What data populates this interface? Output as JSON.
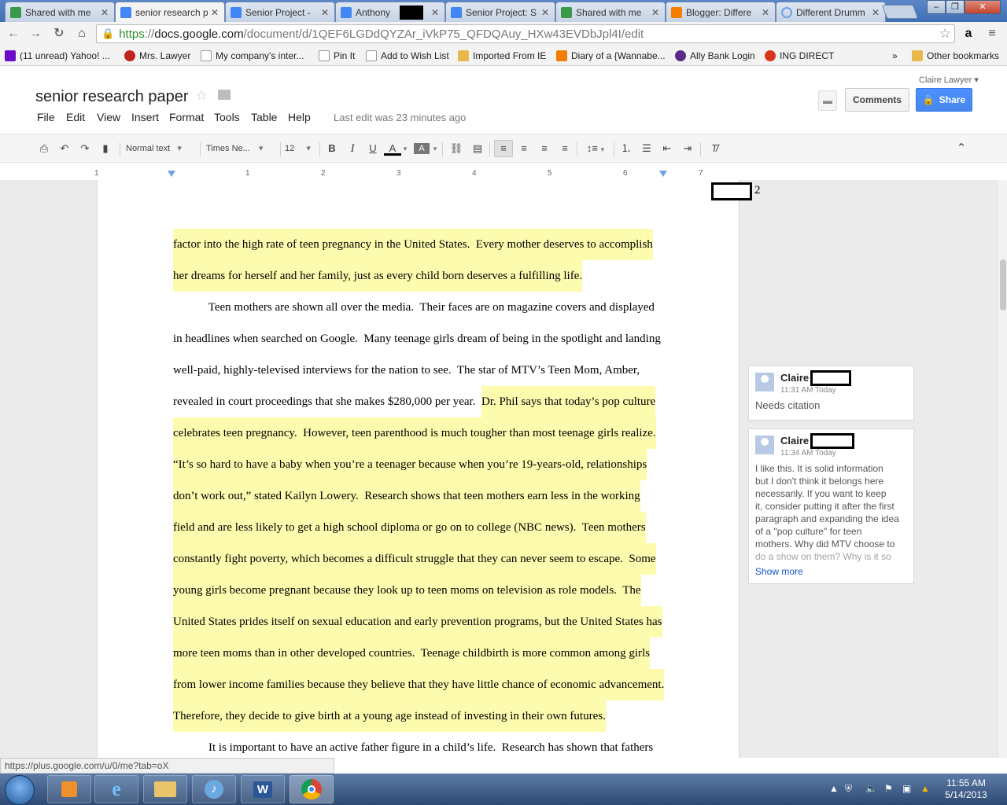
{
  "tabs": [
    {
      "label": "Shared with me",
      "color": "#3b9a4a"
    },
    {
      "label": "senior research paper",
      "color": "#4285f4",
      "active": true
    },
    {
      "label": "Senior Project -",
      "color": "#4285f4"
    },
    {
      "label": "Anthony",
      "color": "#4285f4"
    },
    {
      "label": "Senior Project: S",
      "color": "#4285f4"
    },
    {
      "label": "Shared with me",
      "color": "#3b9a4a"
    },
    {
      "label": "Blogger: Differe",
      "color": "#f57d00"
    },
    {
      "label": "Different Drumm",
      "color": "#6aa1e0"
    }
  ],
  "omnibox": {
    "scheme": "https",
    "sep": "://",
    "host": "docs.google.com",
    "path": "/document/d/1QEF6LGDdQYZAr_iVkP75_QFDQAuy_HXw43EVDbJpl4I/edit"
  },
  "bookmarks": [
    {
      "label": "(11 unread) Yahoo! ...",
      "color": "#6b0ac9"
    },
    {
      "label": "Mrs. Lawyer",
      "color": "#c0251d"
    },
    {
      "label": "My company's inter...",
      "color": "#dddddd"
    },
    {
      "label": "Pin It",
      "color": "#dddddd"
    },
    {
      "label": "Add to Wish List",
      "color": "#dddddd"
    },
    {
      "label": "Imported From IE",
      "color": "#e8b84a"
    },
    {
      "label": "Diary of a {Wannabe...",
      "color": "#f57d00"
    },
    {
      "label": "Ally Bank Login",
      "color": "#5b2c86"
    },
    {
      "label": "ING DIRECT",
      "color": "#d9351c"
    }
  ],
  "bookmarks_more": "»",
  "bookmarks_other": "Other bookmarks",
  "doc": {
    "title": "senior research paper",
    "user": "Claire Lawyer",
    "menu": [
      "File",
      "Edit",
      "View",
      "Insert",
      "Format",
      "Tools",
      "Table",
      "Help"
    ],
    "last_edit": "Last edit was 23 minutes ago",
    "comments_label": "Comments",
    "share_label": "Share"
  },
  "toolbar": {
    "style": "Normal text",
    "font": "Times Ne...",
    "size": "12"
  },
  "ruler": [
    "1",
    "1",
    "2",
    "3",
    "4",
    "5",
    "6",
    "7"
  ],
  "page_number": "2",
  "lines": [
    {
      "text": "factor into the high rate of teen pregnancy in the United States.  Every mother deserves to accomplish",
      "hl": true
    },
    {
      "text": "her dreams for herself and her family, just as every child born deserves a fulfilling life.",
      "hl": true
    },
    {
      "text": "            Teen mothers are shown all over the media.  Their faces are on magazine covers and displayed",
      "hl": false
    },
    {
      "text": "in headlines when searched on Google.  Many teenage girls dream of being in the spotlight and landing",
      "hl": false
    },
    {
      "text": "well-paid, highly-televised interviews for the nation to see.  The star of MTV’s Teen Mom, Amber,",
      "hl": false
    },
    {
      "pre": "revealed in court proceedings that she makes $280,000 per year.  ",
      "text": "Dr. Phil says that today’s pop culture",
      "hl": true
    },
    {
      "text": "celebrates teen pregnancy.  However, teen parenthood is much tougher than most teenage girls realize.",
      "hl": true
    },
    {
      "text": "“It’s so hard to have a baby when you’re a teenager because when you’re 19-years-old, relationships",
      "hl": true
    },
    {
      "text": "don’t work out,” stated Kailyn Lowery.  Research shows that teen mothers earn less in the working",
      "hl": true
    },
    {
      "text": "field and are less likely to get a high school diploma or go on to college (NBC news).  Teen mothers",
      "hl": true
    },
    {
      "text": "constantly fight poverty, which becomes a difficult struggle that they can never seem to escape.  Some",
      "hl": true
    },
    {
      "text": "young girls become pregnant because they look up to teen moms on television as role models.  The",
      "hl": true
    },
    {
      "text": "United States prides itself on sexual education and early prevention programs, but the United States has",
      "hl": true
    },
    {
      "text": "more teen moms than in other developed countries.  Teenage childbirth is more common among girls",
      "hl": true
    },
    {
      "text": "from lower income families because they believe that they have little chance of economic advancement.",
      "hl": true
    },
    {
      "text": "Therefore, they decide to give birth at a young age instead of investing in their own futures.",
      "hl": true
    },
    {
      "text": "            It is important to have an active father figure in a child’s life.  Research has shown that fathers",
      "hl": false
    }
  ],
  "comments": [
    {
      "author": "Claire",
      "time": "11:31 AM Today",
      "body": [
        "Needs citation"
      ]
    },
    {
      "author": "Claire",
      "time": "11:34 AM Today",
      "body": [
        "I like this. It is solid information",
        "but I don't think it belongs here",
        "necessarily. If you want to keep",
        "it, consider putting it after the first",
        "paragraph and expanding the idea",
        "of a \"pop culture\" for teen",
        "mothers. Why did MTV choose to",
        "do a show on them? Why is it so"
      ],
      "more": "Show more"
    }
  ],
  "status_url": "https://plus.google.com/u/0/me?tab=oX",
  "taskbar": {
    "word_label": "W"
  },
  "clock": {
    "time": "11:55 AM",
    "date": "5/14/2013"
  }
}
